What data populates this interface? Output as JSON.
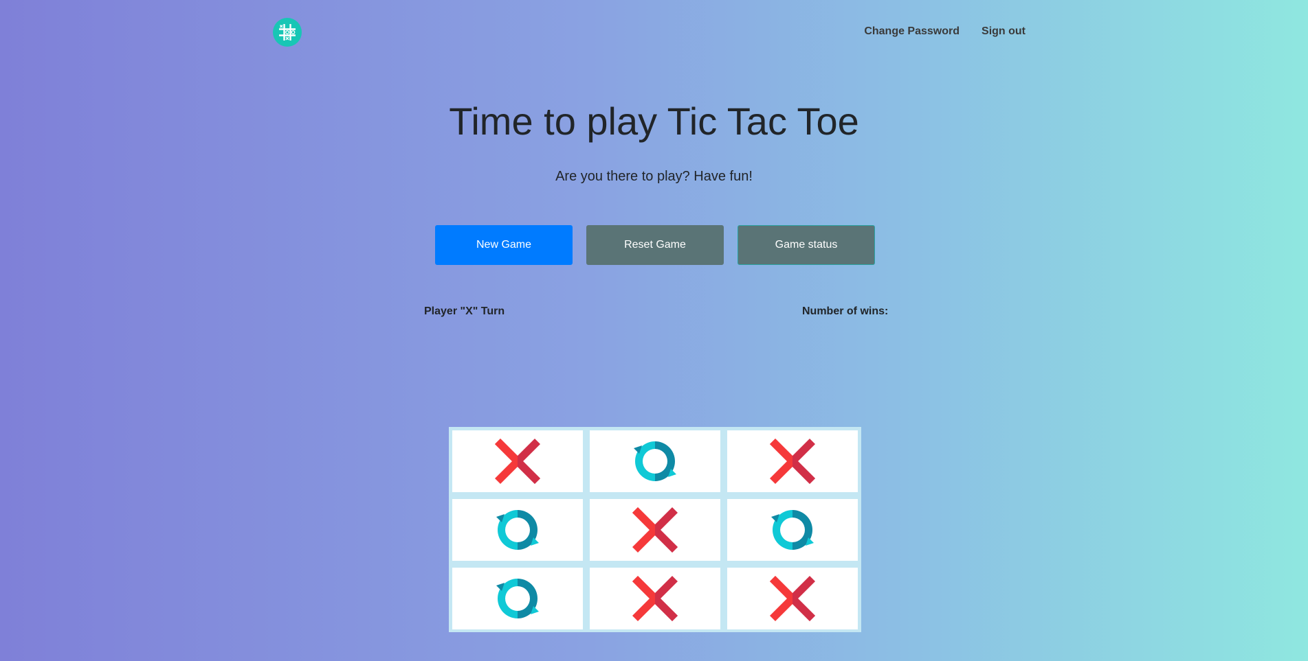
{
  "header": {
    "logo_icon": "tic-tac-toe-logo-icon",
    "nav": {
      "change_password": "Change Password",
      "sign_out": "Sign out"
    }
  },
  "hero": {
    "title": "Time to play Tic Tac Toe",
    "subtitle": "Are you there to play? Have fun!"
  },
  "buttons": {
    "new_game": "New Game",
    "reset_game": "Reset Game",
    "game_status": "Game status"
  },
  "status": {
    "turn": "Player \"X\" Turn",
    "wins_label": "Number of wins:"
  },
  "board": {
    "cells": [
      "X",
      "O",
      "X",
      "O",
      "X",
      "O",
      "O",
      "X",
      "X"
    ]
  },
  "colors": {
    "primary": "#007bff",
    "secondary": "#5a7476",
    "x_light": "#f5393a",
    "x_dark": "#d12f47",
    "o_light": "#10c9d6",
    "o_dark": "#0f8aa5",
    "board_bg": "#c4e7f3"
  }
}
